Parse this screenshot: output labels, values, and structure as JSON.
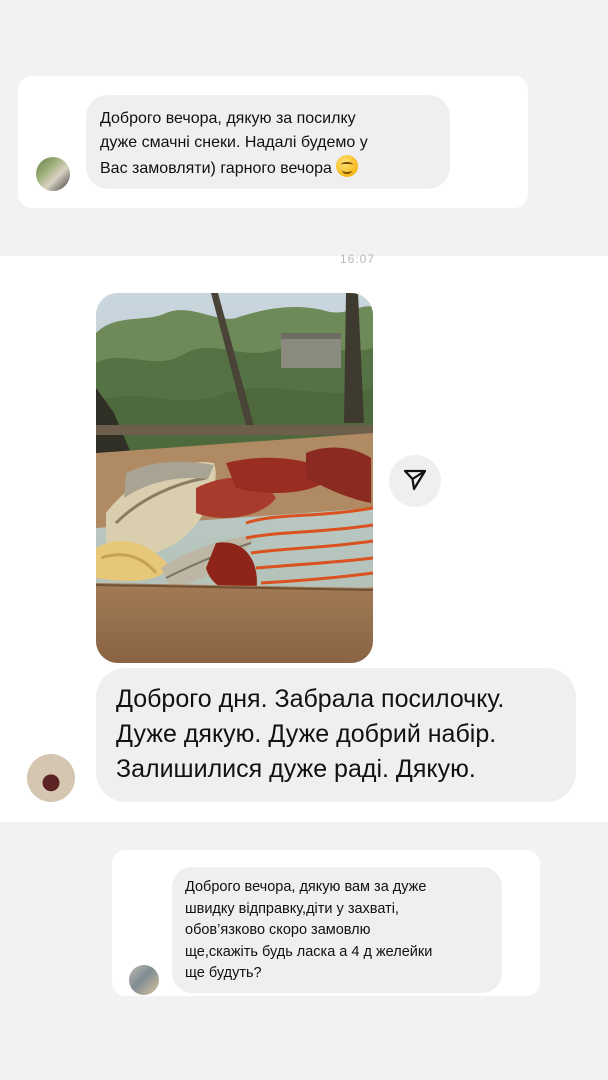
{
  "top_message": {
    "lines": [
      "Доброго вечора, дякую за посилку",
      "дуже смачні снеки. Надалі будемо у",
      "Вас замовляти) гарного вечора"
    ],
    "emoji": "smiling-face-emoji"
  },
  "middle_message": {
    "timestamp": "16:07",
    "lines": [
      "Доброго дня. Забрала посилочку.",
      "Дуже дякую. Дуже добрий набір.",
      "Залишилися дуже раді. Дякую."
    ]
  },
  "bottom_message": {
    "lines": [
      "Доброго вечора, дякую вам за дуже",
      "швидку відправку,діти у захваті,",
      "обов’язково скоро замовлю",
      "ще,скажіть будь ласка а 4 д желейки",
      "ще будуть?"
    ]
  },
  "icons": {
    "share": "share-icon"
  },
  "colors": {
    "panel_background": "#f2f2f3",
    "bubble_background": "#efeff1",
    "text": "#111111"
  }
}
